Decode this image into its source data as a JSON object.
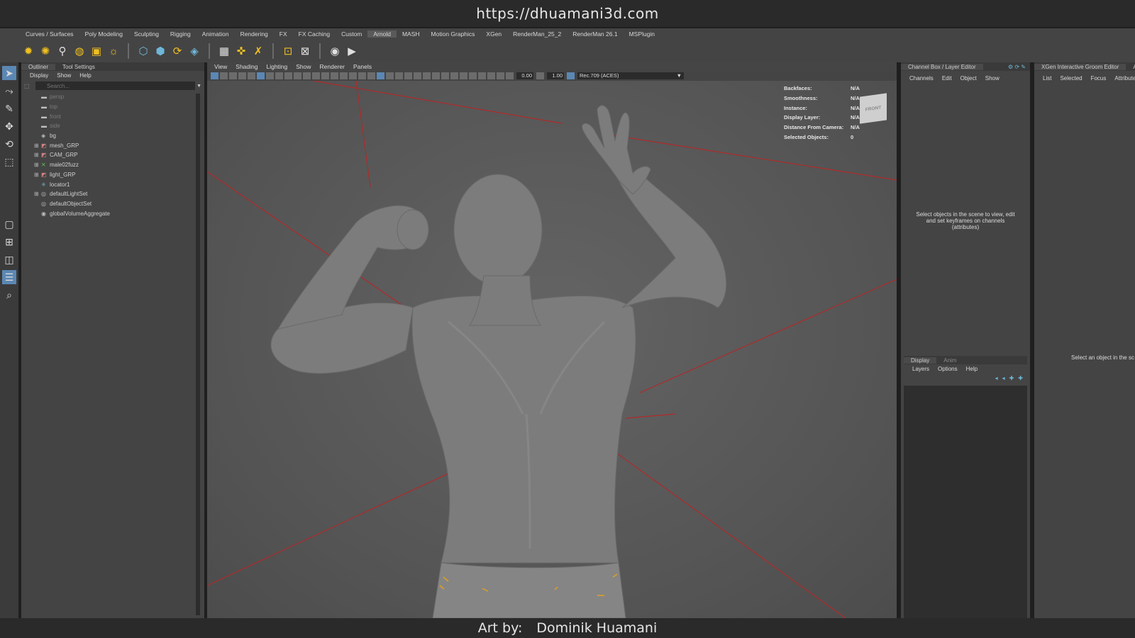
{
  "banner": {
    "url": "https://dhuamani3d.com",
    "credit_label": "Art by:",
    "credit_name": "Dominik Huamani"
  },
  "shelf": {
    "tabs": [
      "Curves / Surfaces",
      "Poly Modeling",
      "Sculpting",
      "Rigging",
      "Animation",
      "Rendering",
      "FX",
      "FX Caching",
      "Custom",
      "Arnold",
      "MASH",
      "Motion Graphics",
      "XGen",
      "RenderMan_25_2",
      "RenderMan 26.1",
      "MSPlugin"
    ],
    "active_tab": "Arnold",
    "icons": [
      "area-light-icon",
      "point-light-icon",
      "spot-light-icon",
      "skydome-light-icon",
      "mesh-light-icon",
      "sun-light-icon",
      "shader-icon",
      "render-view-icon",
      "ipr-icon",
      "cube-icon",
      "checker-icon",
      "pin-icon",
      "remove-icon",
      "frame-icon",
      "select-icon",
      "eye-icon",
      "play-icon"
    ]
  },
  "colors": {
    "accent": "#5b87b4",
    "red_line": "#b02a2a",
    "orange_marker": "#e0a020",
    "panel_bg": "#444444",
    "viewport_bg": "#5a5a5a"
  },
  "outliner": {
    "tabs": [
      "Outliner",
      "Tool Settings"
    ],
    "menu": [
      "Display",
      "Show",
      "Help"
    ],
    "search_placeholder": "Search...",
    "items": [
      {
        "label": "persp",
        "icon": "camera-icon",
        "dim": true,
        "expandable": false
      },
      {
        "label": "top",
        "icon": "camera-icon",
        "dim": true,
        "expandable": false
      },
      {
        "label": "front",
        "icon": "camera-icon",
        "dim": true,
        "expandable": false
      },
      {
        "label": "side",
        "icon": "camera-icon",
        "dim": true,
        "expandable": false
      },
      {
        "label": "bg",
        "icon": "transform-icon",
        "dim": false,
        "expandable": false
      },
      {
        "label": "mesh_GRP",
        "icon": "group-icon",
        "dim": false,
        "expandable": true
      },
      {
        "label": "CAM_GRP",
        "icon": "group-icon",
        "dim": false,
        "expandable": true
      },
      {
        "label": "male02fuzz",
        "icon": "xgen-icon",
        "dim": false,
        "expandable": true
      },
      {
        "label": "light_GRP",
        "icon": "group-icon",
        "dim": false,
        "expandable": true
      },
      {
        "label": "locator1",
        "icon": "locator-icon",
        "dim": false,
        "expandable": false
      },
      {
        "label": "defaultLightSet",
        "icon": "set-icon",
        "dim": false,
        "expandable": true
      },
      {
        "label": "defaultObjectSet",
        "icon": "set-icon",
        "dim": false,
        "expandable": false
      },
      {
        "label": "globalVolumeAggregate",
        "icon": "volume-icon",
        "dim": false,
        "expandable": false
      }
    ]
  },
  "viewport": {
    "menu": [
      "View",
      "Shading",
      "Lighting",
      "Show",
      "Renderer",
      "Panels"
    ],
    "exposure": "0.00",
    "gamma": "1.00",
    "color_space": "Rec.709 (ACES)",
    "hud": [
      {
        "label": "Backfaces:",
        "value": "N/A"
      },
      {
        "label": "Smoothness:",
        "value": "N/A"
      },
      {
        "label": "Instance:",
        "value": "N/A"
      },
      {
        "label": "Display Layer:",
        "value": "N/A"
      },
      {
        "label": "Distance From Camera:",
        "value": "N/A"
      },
      {
        "label": "Selected Objects:",
        "value": "0"
      }
    ],
    "viewcube_label": "FRONT"
  },
  "channel_box": {
    "title": "Channel Box / Layer Editor",
    "menu": [
      "Channels",
      "Edit",
      "Object",
      "Show"
    ],
    "message": "Select objects in the scene to view, edit and set keyframes on channels (attributes)",
    "layer_tabs": [
      "Display",
      "Anim"
    ],
    "layer_menu": [
      "Layers",
      "Options",
      "Help"
    ]
  },
  "xgen": {
    "title": "XGen Interactive Groom Editor",
    "title_extra": "At",
    "menu": [
      "List",
      "Selected",
      "Focus",
      "Attributes"
    ],
    "message": "Select an object in the sc"
  }
}
